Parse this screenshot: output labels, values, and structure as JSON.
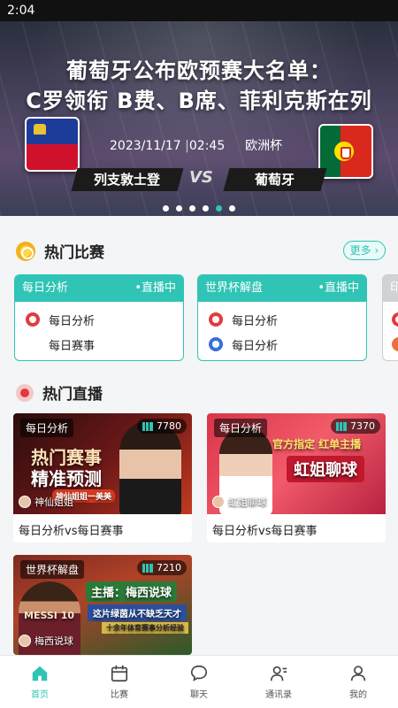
{
  "status_bar": {
    "time": "2:04"
  },
  "banner": {
    "title_line1": "葡萄牙公布欧预赛大名单：",
    "title_line2": "C罗领衔 B费、B席、菲利克斯在列",
    "date": "2023/11/17",
    "time": "02:45",
    "competition": "欧洲杯",
    "team_left": "列支敦士登",
    "team_right": "葡萄牙",
    "vs": "VS",
    "slide_count": 6,
    "active_slide": 5
  },
  "hot_matches": {
    "title": "热门比赛",
    "more_label": "更多",
    "cards": [
      {
        "category": "每日分析",
        "status": "•直播中",
        "rows": [
          {
            "icon": "team-red-icon",
            "label": "每日分析"
          },
          {
            "icon": "",
            "label": "每日赛事"
          }
        ]
      },
      {
        "category": "世界杯解盘",
        "status": "•直播中",
        "rows": [
          {
            "icon": "team-red-icon",
            "label": "每日分析"
          },
          {
            "icon": "team-blue-icon",
            "label": "每日分析"
          }
        ]
      }
    ],
    "partial_card_label": "印"
  },
  "hot_live": {
    "title": "热门直播",
    "streams": [
      {
        "tag": "每日分析",
        "viewers": "7780",
        "streamer": "神仙姐姐",
        "promo_line1": "热门赛事",
        "promo_line2": "精准预测",
        "promo_sub": "神仙姐姐一美美",
        "caption": "每日分析vs每日赛事"
      },
      {
        "tag": "每日分析",
        "viewers": "7370",
        "streamer": "虹姐聊球",
        "promo_line1": "官方指定 红单主播",
        "promo_line2": "虹姐聊球",
        "caption": "每日分析vs每日赛事"
      },
      {
        "tag": "世界杯解盘",
        "viewers": "7210",
        "streamer": "梅西说球",
        "promo_line1": "主播：梅西说球",
        "promo_line2": "这片绿茵从不缺乏天才",
        "promo_sub": "十余年体育赛事分析经验",
        "jersey": "MESSI 10"
      }
    ]
  },
  "tab_bar": {
    "tabs": [
      {
        "label": "首页",
        "icon": "home-icon",
        "active": true
      },
      {
        "label": "比赛",
        "icon": "calendar-icon",
        "active": false
      },
      {
        "label": "聊天",
        "icon": "chat-icon",
        "active": false
      },
      {
        "label": "通讯录",
        "icon": "contacts-icon",
        "active": false
      },
      {
        "label": "我的",
        "icon": "profile-icon",
        "active": false
      }
    ]
  },
  "colors": {
    "accent": "#2fc4b5",
    "live_red": "#e2373d"
  }
}
